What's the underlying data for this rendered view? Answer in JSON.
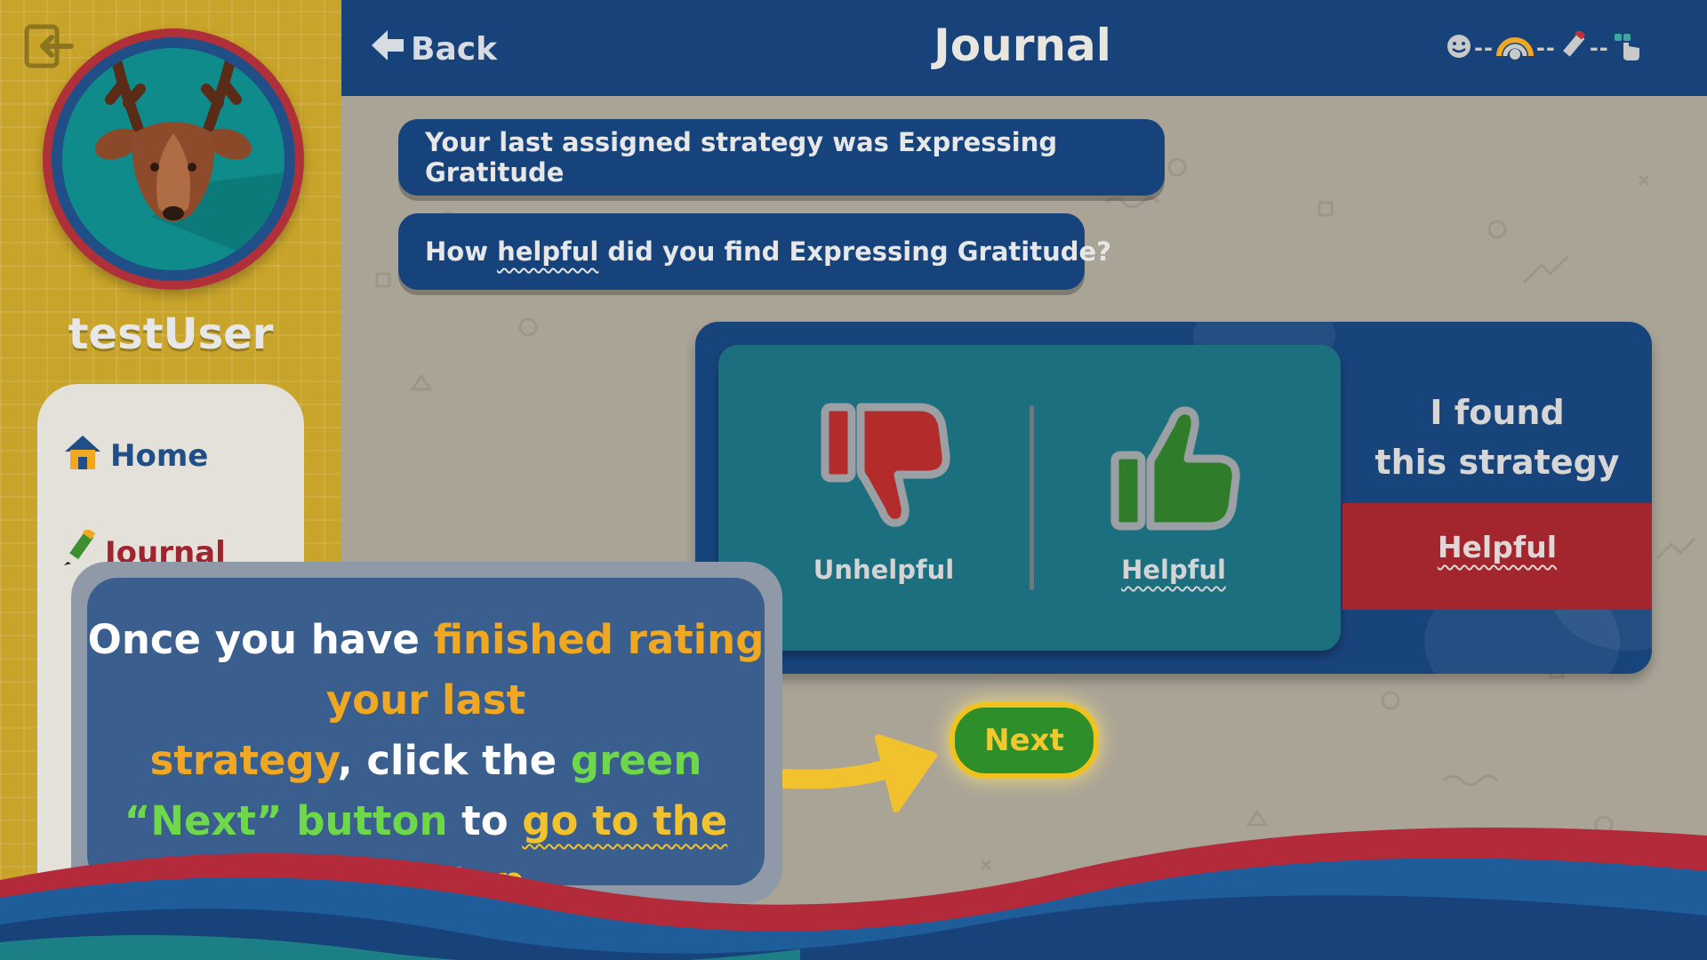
{
  "sidebar": {
    "username": "testUser",
    "nav": [
      {
        "label": "Home",
        "icon": "house-icon"
      },
      {
        "label": "Journal",
        "icon": "pencil-icon"
      }
    ]
  },
  "header": {
    "back_label": "Back",
    "title": "Journal",
    "steps": [
      "smiley-icon",
      "rainbow-icon",
      "pencil-icon",
      "hand-pointer-icon"
    ]
  },
  "main": {
    "bubble_1": "Your last assigned strategy was Expressing Gratitude",
    "bubble_2": {
      "prefix": "How ",
      "highlight": "helpful",
      "suffix": " did you find Expressing Gratitude?"
    },
    "rating": {
      "unhelpful_label": "Unhelpful",
      "helpful_label": "Helpful",
      "found_line1": "I found",
      "found_line2": "this strategy",
      "selected_value": "Helpful"
    },
    "next_label": "Next"
  },
  "tutorial": {
    "part1": "Once you have ",
    "part2": "finished rating your last strategy",
    "part3": ", click the ",
    "part4": "green “Next” button",
    "part5": " to ",
    "part6": "go to the next step."
  },
  "colors": {
    "header_bg": "#17427a",
    "sidebar_bg": "#c9a42a",
    "next_green": "#2e8e2a",
    "highlight_yellow": "#f0c21d",
    "unhelpful_red": "#b32b2b",
    "helpful_green": "#2f7d2a"
  }
}
